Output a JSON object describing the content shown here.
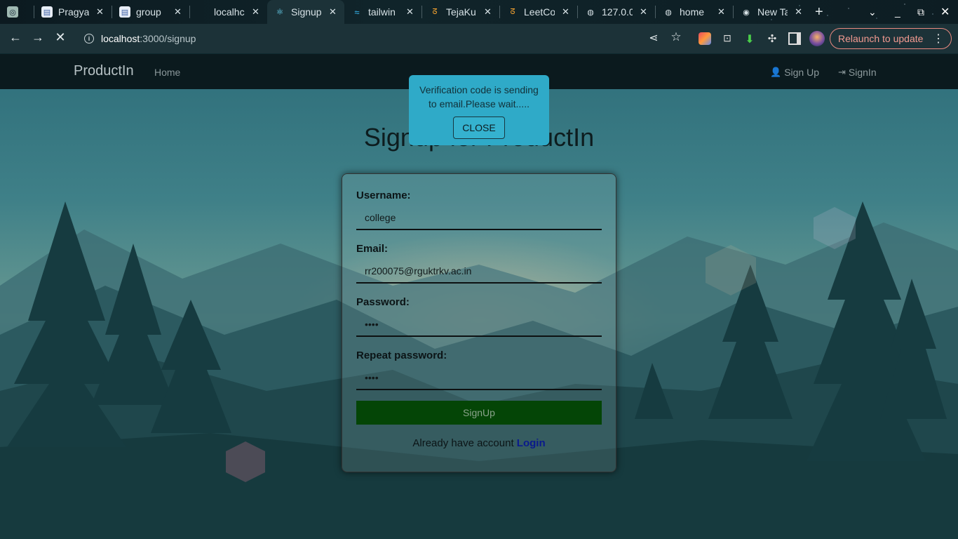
{
  "browser": {
    "tabs": [
      {
        "title": "",
        "icon": "chatgpt-icon",
        "active": false
      },
      {
        "title": "Pragya",
        "icon": "doc-icon",
        "active": false
      },
      {
        "title": "group",
        "icon": "doc-icon",
        "active": false
      },
      {
        "title": "localhc",
        "icon": "react-icon",
        "active": false
      },
      {
        "title": "Signup",
        "icon": "react-icon",
        "active": true
      },
      {
        "title": "tailwin",
        "icon": "tailwind-icon",
        "active": false
      },
      {
        "title": "TejaKu",
        "icon": "leetcode-icon",
        "active": false
      },
      {
        "title": "LeetCo",
        "icon": "leetcode-icon",
        "active": false
      },
      {
        "title": "127.0.0",
        "icon": "globe-icon",
        "active": false
      },
      {
        "title": "home",
        "icon": "globe-icon",
        "active": false
      },
      {
        "title": "New Ta",
        "icon": "chrome-icon",
        "active": false
      }
    ],
    "address": {
      "host": "localhost",
      "path": ":3000/signup"
    },
    "relaunch_label": "Relaunch to update"
  },
  "navbar": {
    "brand": "ProductIn",
    "home": "Home",
    "signup": "Sign Up",
    "signin": "SignIn"
  },
  "page": {
    "title": "Signup for ProductIn"
  },
  "form": {
    "username_label": "Username:",
    "username_value": "college",
    "email_label": "Email:",
    "email_value": "rr200075@rguktrkv.ac.in",
    "password_label": "Password:",
    "password_value": "••••",
    "repeat_label": "Repeat password:",
    "repeat_value": "••••",
    "submit_label": "SignUp",
    "already_text": "Already have account",
    "login_link": "Login"
  },
  "toast": {
    "message_line1": "Verification code is sending",
    "message_line2": "to email.Please wait.....",
    "close_label": "CLOSE"
  },
  "colors": {
    "navbar_bg": "#0b1a1e",
    "toast_bg": "#2faac8",
    "signup_btn": "#044506",
    "login_link": "#0a1a8c",
    "relaunch": "#f29a90"
  }
}
